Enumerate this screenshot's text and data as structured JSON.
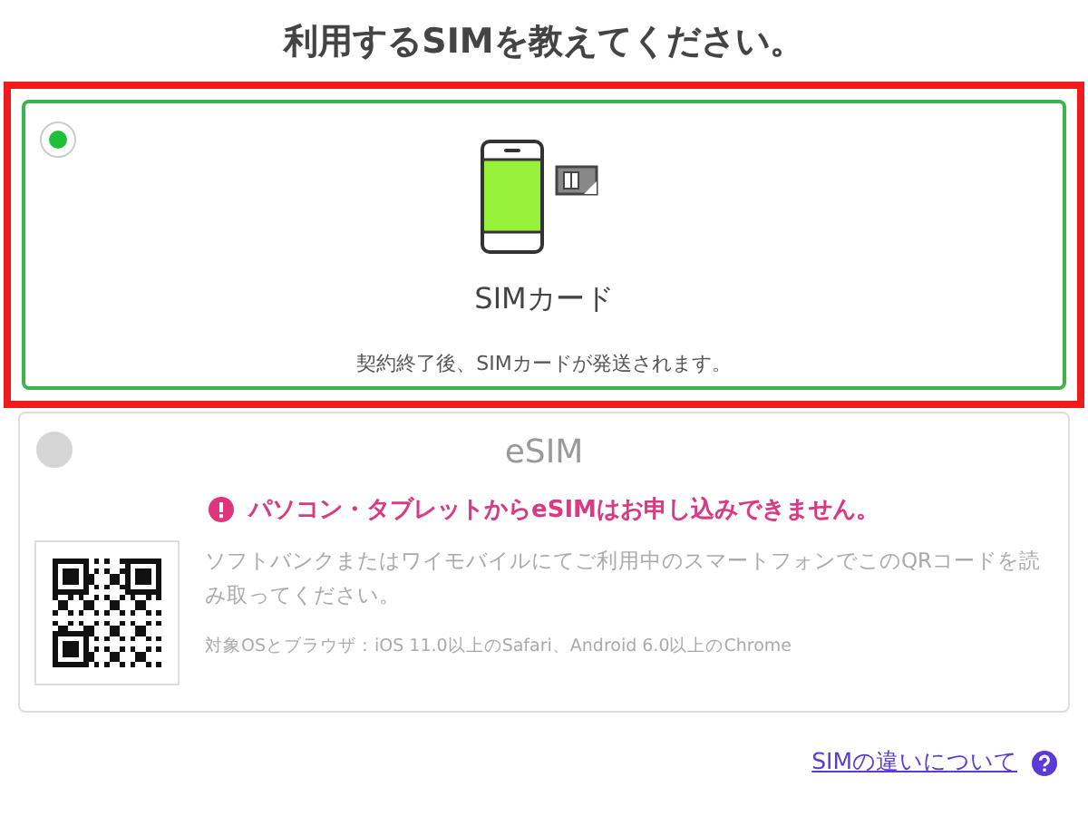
{
  "title": "利用するSIMを教えてください。",
  "options": [
    {
      "kind": "sim-card",
      "label": "SIMカード",
      "selected": true,
      "highlighted": true,
      "disabled": false,
      "description": "契約終了後、SIMカードが発送されます。"
    },
    {
      "kind": "esim",
      "label": "eSIM",
      "selected": false,
      "highlighted": false,
      "disabled": true,
      "warning": "パソコン・タブレットからeSIMはお申し込みできません。",
      "instruction": "ソフトバンクまたはワイモバイルにてご利用中のスマートフォンでこのQRコードを読み取ってください。",
      "note": "対象OSとブラウザ：iOS 11.0以上のSafari、Android 6.0以上のChrome"
    }
  ],
  "help_link": "SIMの違いについて"
}
